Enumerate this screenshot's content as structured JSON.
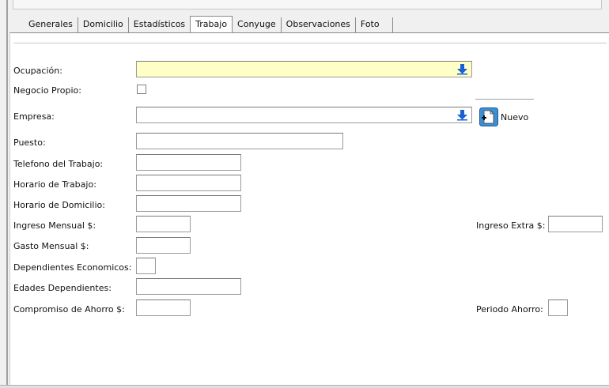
{
  "tabs": [
    {
      "label": "Generales",
      "active": false
    },
    {
      "label": "Domicilio",
      "active": false
    },
    {
      "label": "Estadísticos",
      "active": false
    },
    {
      "label": "Trabajo",
      "active": true
    },
    {
      "label": "Conyuge",
      "active": false
    },
    {
      "label": "Observaciones",
      "active": false
    },
    {
      "label": "Foto",
      "active": false
    }
  ],
  "form": {
    "ocupacion": {
      "label": "Ocupación:",
      "value": ""
    },
    "negocio_propio": {
      "label": "Negocio Propio:",
      "checked": false
    },
    "empresa": {
      "label": "Empresa:",
      "value": ""
    },
    "nuevo_label": "Nuevo",
    "puesto": {
      "label": "Puesto:",
      "value": ""
    },
    "telefono_trabajo": {
      "label": "Telefono del Trabajo:",
      "value": ""
    },
    "horario_trabajo": {
      "label": "Horario de Trabajo:",
      "value": ""
    },
    "horario_domicilio": {
      "label": "Horario de Domicilio:",
      "value": ""
    },
    "ingreso_mensual": {
      "label": "Ingreso Mensual $:",
      "value": ""
    },
    "ingreso_extra": {
      "label": "Ingreso Extra $:",
      "value": ""
    },
    "gasto_mensual": {
      "label": "Gasto Mensual $:",
      "value": ""
    },
    "dependientes_economicos": {
      "label": "Dependientes Economicos:",
      "value": ""
    },
    "edades_dependientes": {
      "label": "Edades Dependientes:",
      "value": ""
    },
    "compromiso_ahorro": {
      "label": "Compromiso de Ahorro $:",
      "value": ""
    },
    "periodo_ahorro": {
      "label": "Periodo Ahorro:",
      "value": ""
    }
  },
  "colors": {
    "required_field_bg": "#ffffc6",
    "arrow_blue": "#1a5fd6"
  },
  "icons": {
    "combo_dropdown": "down-arrow-icon",
    "nuevo": "new-document-icon"
  }
}
